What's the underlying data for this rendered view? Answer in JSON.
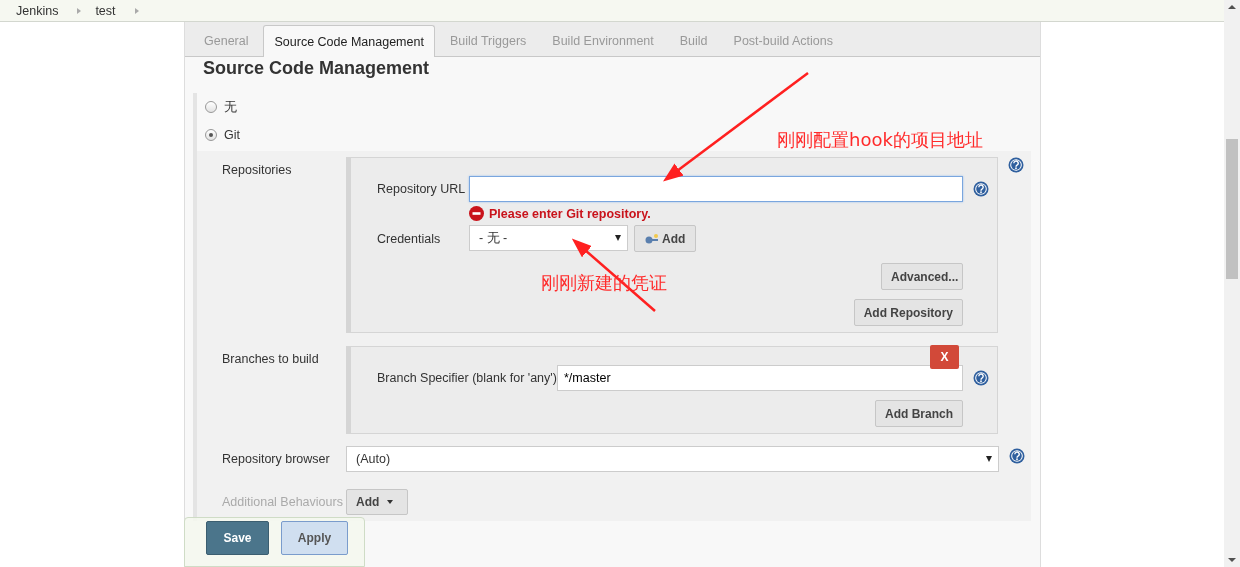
{
  "breadcrumb": [
    {
      "label": "Jenkins"
    },
    {
      "label": "test"
    }
  ],
  "tabs": [
    {
      "label": "General",
      "selected": false
    },
    {
      "label": "Source Code Management",
      "selected": true
    },
    {
      "label": "Build Triggers",
      "selected": false
    },
    {
      "label": "Build Environment",
      "selected": false
    },
    {
      "label": "Build",
      "selected": false
    },
    {
      "label": "Post-build Actions",
      "selected": false
    }
  ],
  "section_title": "Source Code Management",
  "scm_options": [
    {
      "label": "无",
      "selected": false
    },
    {
      "label": "Git",
      "selected": true
    }
  ],
  "repositories": {
    "label": "Repositories",
    "url_label": "Repository URL",
    "url_error": "Please enter Git repository.",
    "credentials_label": "Credentials",
    "credentials_value": "- 无 -",
    "credentials_add": "Add",
    "advanced_button": "Advanced...",
    "add_repository_button": "Add Repository"
  },
  "branches": {
    "label": "Branches to build",
    "delete_button": "X",
    "specifier_label": "Branch Specifier (blank for 'any')",
    "specifier_value": "*/master",
    "add_branch_button": "Add Branch"
  },
  "repository_browser": {
    "label": "Repository browser",
    "value": "(Auto)"
  },
  "additional_behaviours": {
    "label": "Additional Behaviours",
    "add_button": "Add"
  },
  "actions": [
    {
      "label": "Save",
      "kind": "primary"
    },
    {
      "label": "Apply",
      "kind": "secondary"
    }
  ],
  "annotations": [
    {
      "text": "刚刚配置hook的项目地址"
    },
    {
      "text": "刚刚新建的凭证"
    }
  ]
}
